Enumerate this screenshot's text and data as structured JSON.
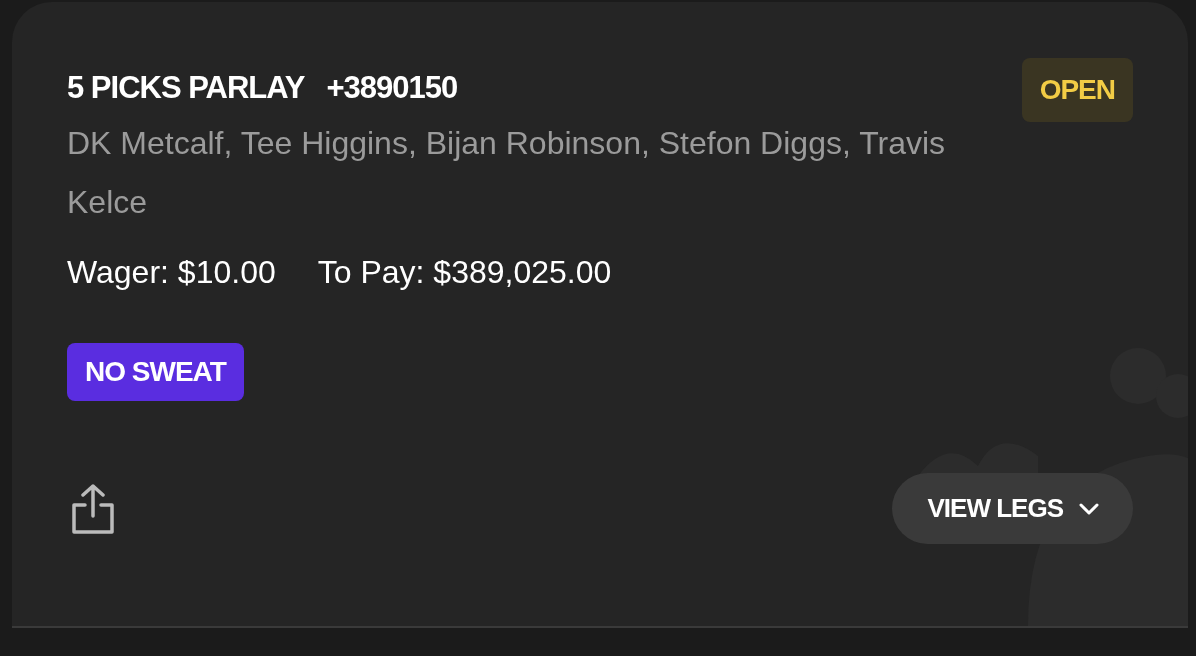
{
  "bet": {
    "title": "5 PICKS PARLAY",
    "odds": "+3890150",
    "status": {
      "label": "OPEN",
      "kind": "open"
    },
    "players": "DK Metcalf, Tee Higgins, Bijan Robinson, Stefon Diggs, Travis Kelce",
    "wager": "Wager: $10.00",
    "to_pay": "To Pay: $389,025.00",
    "promo": "NO SWEAT",
    "view_button": {
      "label": "VIEW LEGS",
      "expanded": false
    }
  }
}
